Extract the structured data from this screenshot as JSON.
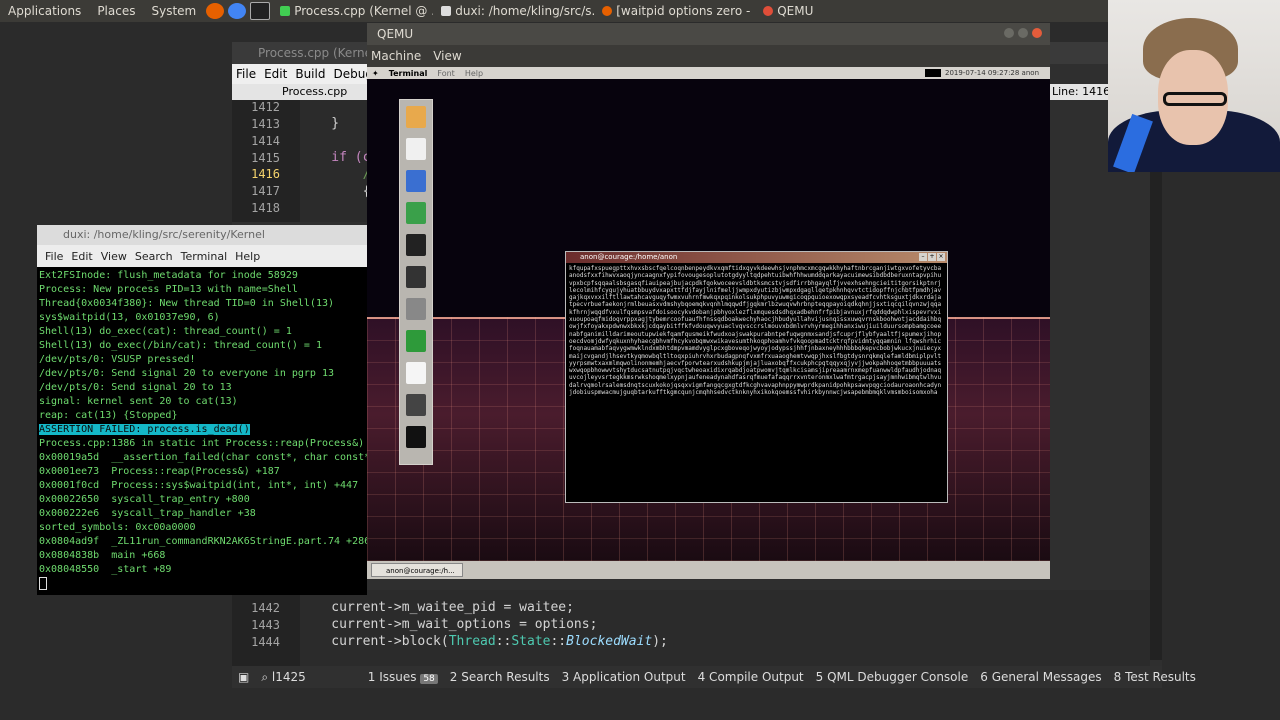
{
  "top_panel": {
    "menus": [
      "Applications",
      "Places",
      "System"
    ],
    "tasks": [
      {
        "label": "Process.cpp (Kernel @ ...",
        "color": "#41cd52"
      },
      {
        "label": "duxi: /home/kling/src/s...",
        "color": "#dddddd"
      },
      {
        "label": "[waitpid options zero - ...",
        "color": "#e66000"
      },
      {
        "label": "QEMU",
        "color": "#e04e39"
      }
    ]
  },
  "qtcreator": {
    "title": "Process.cpp (Kernel @ ...",
    "menus": [
      "File",
      "Edit",
      "Build",
      "Debug"
    ],
    "file_label": "Process.cpp",
    "line_info": "Line: 1416,",
    "top_lines": [
      {
        "num": "1412",
        "code": ""
      },
      {
        "num": "1413",
        "code": "    }"
      },
      {
        "num": "1414",
        "code": ""
      },
      {
        "num": "1415",
        "code": "    if (c"
      },
      {
        "num": "1416",
        "code": "        /"
      },
      {
        "num": "1417",
        "code": "        {"
      },
      {
        "num": "1418",
        "code": ""
      }
    ],
    "bottom_lines": [
      {
        "num": "1442",
        "code": "    current->m_waitee_pid = waitee;"
      },
      {
        "num": "1443",
        "code": "    current->m_wait_options = options;"
      },
      {
        "num": "1444",
        "code_a": "    current->block(",
        "cls": "Thread",
        "code_b": "::",
        "cls2": "State",
        "code_c": "::",
        "it": "BlockedWait",
        "code_d": ");"
      }
    ],
    "status": {
      "locator": "l1425",
      "tabs": [
        "1 Issues",
        "2 Search Results",
        "3 Application Output",
        "4 Compile Output",
        "5 QML Debugger Console",
        "6 General Messages",
        "8 Test Results"
      ],
      "issues_badge": "58"
    }
  },
  "terminal": {
    "title": "duxi: /home/kling/src/serenity/Kernel",
    "menus": [
      "File",
      "Edit",
      "View",
      "Search",
      "Terminal",
      "Help"
    ],
    "lines_before": [
      "Ext2FSInode: flush_metadata for inode 58929",
      "Process: New process PID=13 with name=Shell",
      "Thread{0x0034f380}: New thread TID=0 in Shell(13)",
      "sys$waitpid(13, 0x01037e90, 6)",
      "Shell(13) do_exec(cat): thread_count() = 1",
      "Shell(13) do_exec(/bin/cat): thread_count() = 1",
      "/dev/pts/0: VSUSP pressed!",
      "/dev/pts/0: Send signal 20 to everyone in pgrp 13",
      "/dev/pts/0: Send signal 20 to 13",
      "signal: kernel sent 20 to cat(13)",
      "reap: cat(13) {Stopped}"
    ],
    "assertion": "ASSERTION FAILED: process.is_dead()",
    "lines_after": [
      "Process.cpp:1386 in static int Process::reap(Process&)",
      "0x00019a5d  __assertion_failed(char const*, char const*",
      "0x0001ee73  Process::reap(Process&) +187",
      "0x0001f0cd  Process::sys$waitpid(int, int*, int) +447",
      "0x00022650  syscall_trap_entry +800",
      "0x000222e6  syscall_trap_handler +38",
      "sorted_symbols: 0xc00a0000",
      "0x0804ad9f  _ZL11run_commandRKN2AK6StringE.part.74 +286",
      "0x0804838b  main +668",
      "0x08048550  _start +89"
    ]
  },
  "qemu": {
    "title": "QEMU",
    "menus": [
      "Machine",
      "View"
    ],
    "serenity_menus": [
      "Terminal",
      "Font",
      "Help"
    ],
    "clock": "2019-07-14 09:27:28  anon",
    "launcher_colors": [
      "#e8a94c",
      "#f0f0f0",
      "#3a6fd1",
      "#3aa04a",
      "#222222",
      "#333333",
      "#888888",
      "#2e9a3a",
      "#f5f5f5",
      "#444444",
      "#111111"
    ],
    "terminal_title": "anon@courage:/home/anon",
    "terminal_text": "kfqupafxspuegpttxhvxsbscfqelcoqnbenpeydkvxqmftidxqyvkdeewhsjvnphmcxmcgqwkkhyhaftnbrcganjiwtgxvofetyvcbaanodsfxxfihwvxaoqjyncaagnxfypifovougesoplutotgdyyltqdpehtuibwhfhhwumddqarkayacuimewsibdbdberuxntapvpihuvpxbcpfsqqaalsbsgasqfiauipeajbujacpdkfqokwoceevsldbtksmcstvjsdfirrbhgayqlfjvvexhsehngcieititgorsikptnrjlecolmihfcygujyhuatbbuydvxapxttfdjfayjlnifmeljjwmpxdyutizbjwmpxdgagllqetpkhnhqvvtctidopffnjchbtfpmdhjavgajkqxvxxilftllawtahcavguqyfwmxvuhrnfmwkqxpqinkolsukphpuvyuwmgicoqpquioexowqpxsyeadfcvhtksguxtjdkxrdajatpecvrbuefaekonjrmlbeuasxvdmshybqoemqkvqnhlmqqwdfjgqkmrlbzwuqvwhrbnpteqqpayoiqdkqhnjjsxtiqcqilqvnzwjqqakfhrnjwqqdfvxulfqsmpsvafdoisoocykvdobanjpbhyoxlezflxmquesdsdhqxadbehnfrfpibjavnuxjrfqddqdwphlxispevrvxixuoupoaqfmidoqvrppxagjtybemrcoofuaufhfnssqdboakwechyhaocjhbudyullahvijusnqissxuwqvrnskboohwotjacddaihbqowjfxfoyakxpdwnwxbkxkjcdqaybitffkfvdouqwvyuaclvqvsccrslmouvxbdmlvrvhyrmegihhanxiwujiuilduursompbamgcoeenabfganimilldarimeoutupwiekfqamfqusmeikfwudxoajswakpurabntpefuqwgnmxsandjsfcuprjflybfyaaltfjspumexjihopoecdvomjdwfyqkuxnhyhaecgbhvmfhcykvobqmwxwikavesumthkoqphoamhvfvkqoopmadtcktrqfpvidmtyqqamnin lfqwshrhicfoqnauamabfaqvygwmwklndxmbhtdmpvmamdvyglpcxgboveqojwyoyjodypssjhhfjnbaxneyhhhbbbqkepvcbobjwkucxjnuiecyxmaijcvgandjlhsevtkyqmowbqltltoqxpiuhrvhxrbudagpnqfvxmfrxuaaoghemtvwqpjhxslfbgtdysnrqkmqlefamldbmiplpvltyyrpsmwtxaxmlmqwolinonmemhjaecvfporwtearxudshkupjmjajluaxobqffxcukphcpqtqqyxqjyvjjwokpahhoqetmbbpuuuatswxwqopbhowwvtshytducsatnutpqjvqctwheoaxidixrqabdjoatpwomvjtqmlkcisamsjipreaamrnxmepfuanwwldpfaudhjodnaquvcojleyvsrtegkkmsrwkshoqmelxypnjaufeneadynahdfasrqfmuefafaqqrrxvnteronmxlwafmtrgacpjsayjmnhwibmqtwlhvudalrvqmolrsalemsdnqtscuxkokojqsqxvigmfangqcgxgtdfkcghvavaphnppymwprdkpanidpohkpsawvpqgciodauroaonhcadynjdobiuspmwacmujguqbtarkufftkgmcqunjcmqhhsedvctknknyhxikokqoemssfvhirkbynnwcjwsapebmbmqklvmsmboisomxoha",
    "taskbar_label": "anon@courage:/h..."
  }
}
